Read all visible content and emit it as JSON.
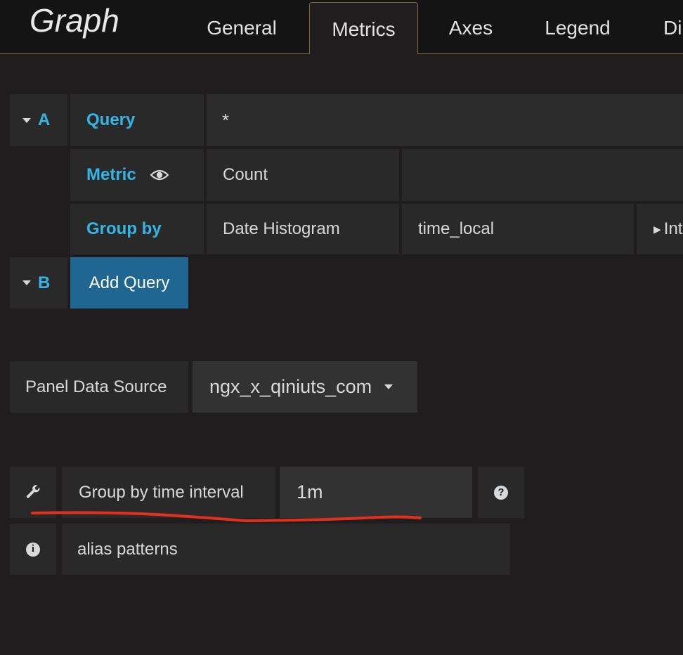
{
  "panel": {
    "title": "Graph"
  },
  "tabs": [
    "General",
    "Metrics",
    "Axes",
    "Legend",
    "Di"
  ],
  "queries": [
    {
      "ref": "A",
      "query_label": "Query",
      "query_value": "*",
      "metric_label": "Metric",
      "metric_type": "Count",
      "group_by_label": "Group by",
      "group_by_type": "Date Histogram",
      "group_by_field": "time_local",
      "interval_label": "Int"
    },
    {
      "ref": "B",
      "add_label": "Add Query"
    }
  ],
  "datasource": {
    "label": "Panel Data Source",
    "value": "ngx_x_qiniuts_com"
  },
  "options": {
    "interval_label": "Group by time interval",
    "interval_value": "1m",
    "alias_label": "alias patterns"
  },
  "colors": {
    "accent": "#33b5e5",
    "annotation": "#e0301e",
    "add_query_bg": "#1f6693"
  },
  "icons": [
    "caret-down-icon",
    "eye-icon",
    "caret-right-icon",
    "wrench-icon",
    "question-icon",
    "info-icon"
  ]
}
